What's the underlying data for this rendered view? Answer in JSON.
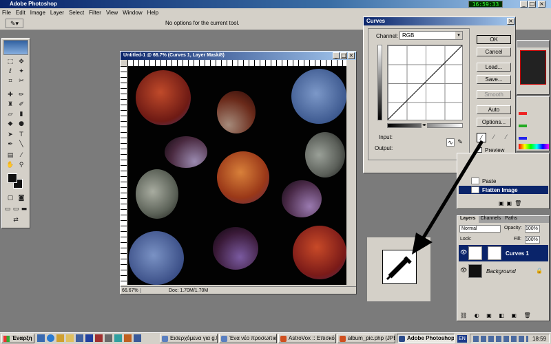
{
  "app": {
    "title": "Adobe Photoshop",
    "clock": "16:59:33"
  },
  "menu": [
    "File",
    "Edit",
    "Image",
    "Layer",
    "Select",
    "Filter",
    "View",
    "Window",
    "Help"
  ],
  "options_bar": {
    "message": "No options for the current tool."
  },
  "document": {
    "title": "Untitled-1 @ 66.7% (Curves 1, Layer Mask/8)",
    "zoom": "66.67%",
    "doc_info": "Doc: 1.70M/1.70M"
  },
  "curves": {
    "title": "Curves",
    "channel_label": "Channel:",
    "channel_value": "RGB",
    "input_label": "Input:",
    "output_label": "Output:",
    "ok": "OK",
    "cancel": "Cancel",
    "load": "Load...",
    "save": "Save...",
    "smooth": "Smooth",
    "auto": "Auto",
    "options": "Options...",
    "preview": "Preview"
  },
  "history": {
    "items": [
      "Paste",
      "Flatten Image"
    ]
  },
  "layers": {
    "tabs": [
      "Layers",
      "Channels",
      "Paths"
    ],
    "blend_mode": "Normal",
    "opacity_label": "Opacity:",
    "opacity": "100%",
    "lock_label": "Lock:",
    "fill_label": "Fill:",
    "fill": "100%",
    "items": [
      {
        "name": "Curves 1"
      },
      {
        "name": "Background"
      }
    ]
  },
  "taskbar": {
    "start": "Έναρξη",
    "items": [
      "Εισερχόμενα για g.t...",
      "Ένα νέο προσωπικό...",
      "AstroVox :: Επισκό...",
      "album_pic.php (JPE...",
      "Adobe Photoshop"
    ],
    "lang": "EN",
    "time": "18:59"
  },
  "colors": {
    "title_bar": "#0a246a",
    "title_bar_end": "#a6caf0",
    "workspace": "#7b7b7b",
    "chrome": "#d4d0c8",
    "selected": "#0a246a",
    "taskbar": "#d4d0c8",
    "clock_bg": "#004000",
    "clock_fg": "#00ff00"
  }
}
